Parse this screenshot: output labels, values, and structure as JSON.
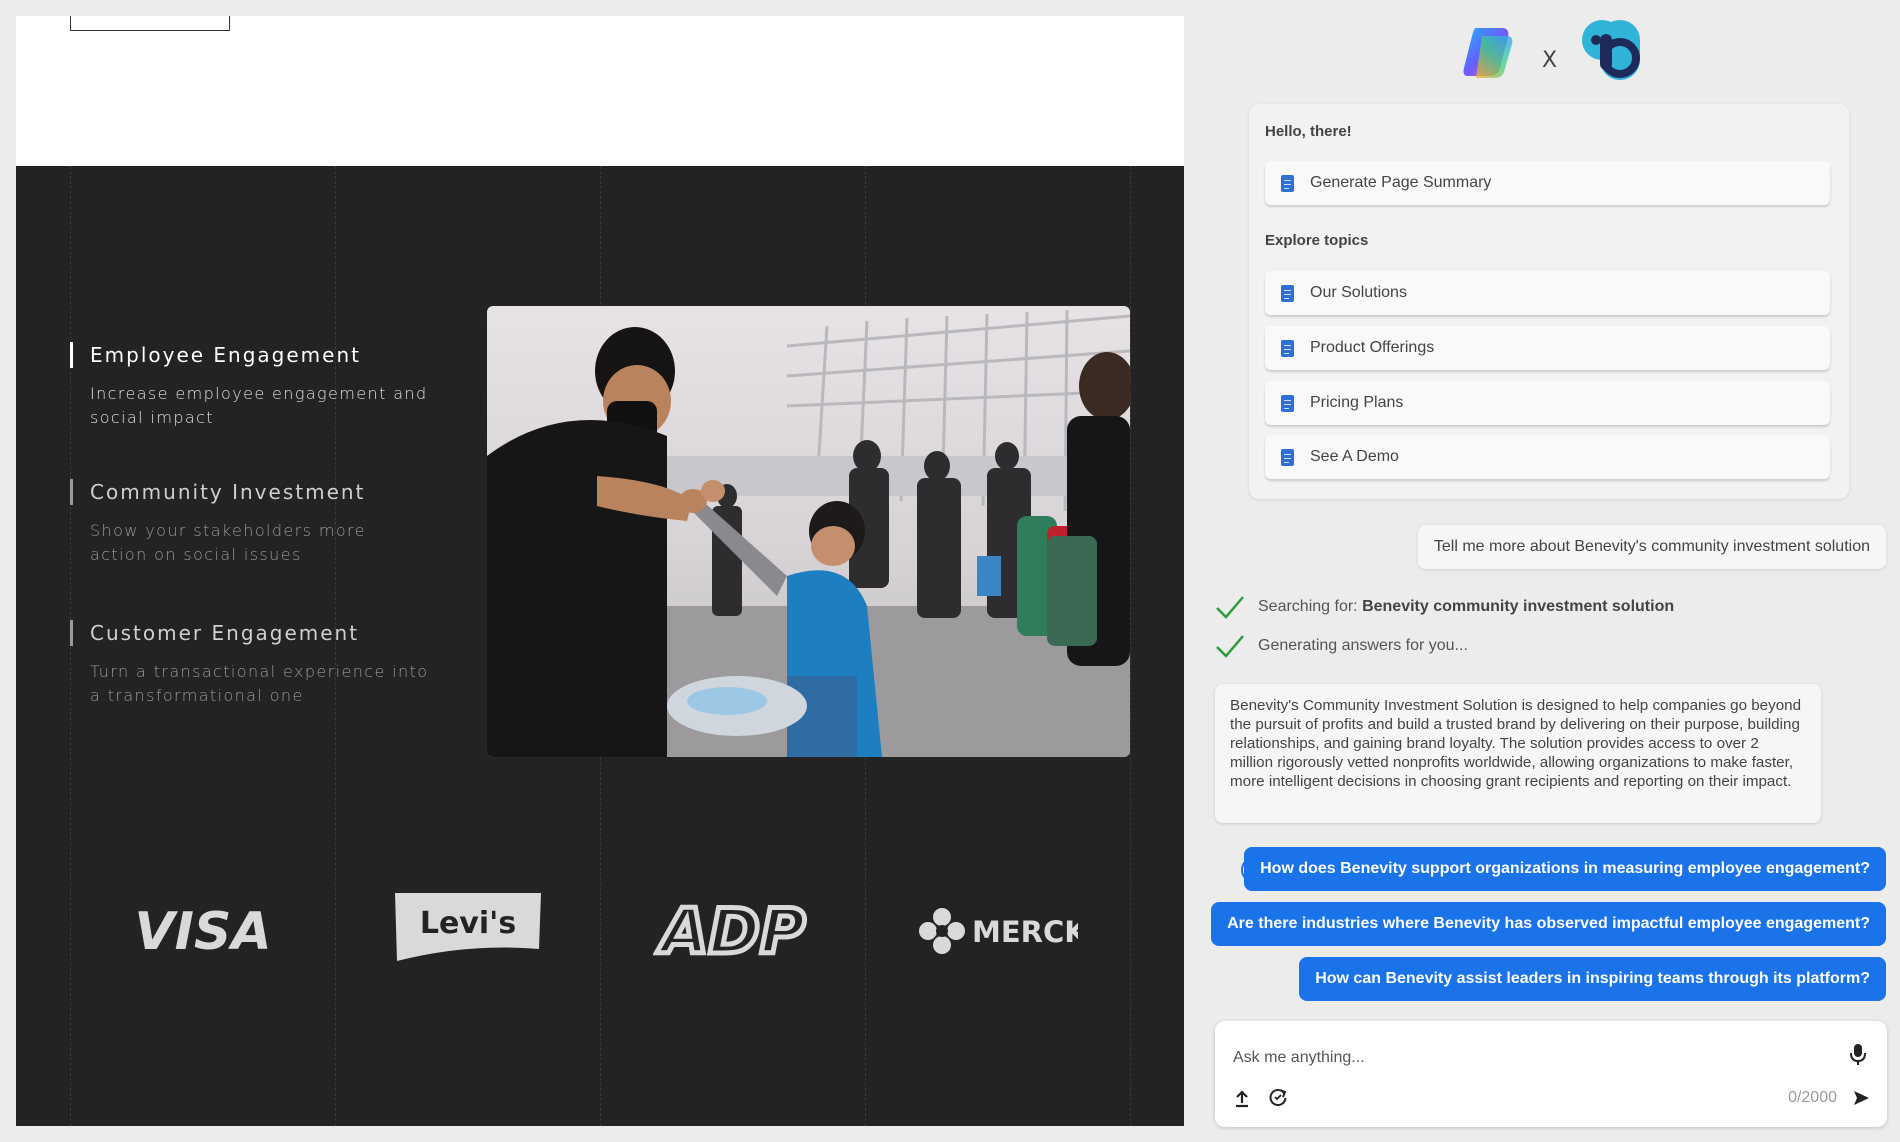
{
  "site": {
    "features": [
      {
        "title": "Employee Engagement",
        "description": "Increase employee engagement and social impact"
      },
      {
        "title": "Community Investment",
        "description": "Show your stakeholders more action on social issues"
      },
      {
        "title": "Customer Engagement",
        "description": "Turn a transactional experience into a transformational one"
      }
    ],
    "logos": [
      "VISA",
      "Levi's",
      "ADP",
      "MERCK"
    ]
  },
  "copilot": {
    "separator": "X",
    "greeting": "Hello, there!",
    "summary_button": "Generate Page Summary",
    "explore_heading": "Explore topics",
    "topics": [
      "Our Solutions",
      "Product Offerings",
      "Pricing Plans",
      "See A Demo"
    ],
    "user_message": "Tell me more about Benevity's community investment solution",
    "status": {
      "searching_prefix": "Searching for:",
      "searching_query": "Benevity community investment solution",
      "generating": "Generating answers for you..."
    },
    "answer": "Benevity's Community Investment Solution is designed to help companies go beyond the pursuit of profits and build a trusted brand by delivering on their purpose, building relationships, and gaining brand loyalty. The solution provides access to over 2 million rigorously vetted nonprofits worldwide, allowing organizations to make faster, more intelligent decisions in choosing grant recipients and reporting on their impact.",
    "suggestions": [
      "How does Benevity support organizations in measuring employee engagement?",
      "Are there industries where Benevity has observed impactful employee engagement?",
      "How can Benevity assist leaders in inspiring teams through its platform?"
    ],
    "composer": {
      "placeholder": "Ask me anything...",
      "counter": "0/2000"
    },
    "colors": {
      "accent": "#1a73e8",
      "check": "#2e9b3f",
      "doc_icon": "#2f6fd8"
    }
  }
}
